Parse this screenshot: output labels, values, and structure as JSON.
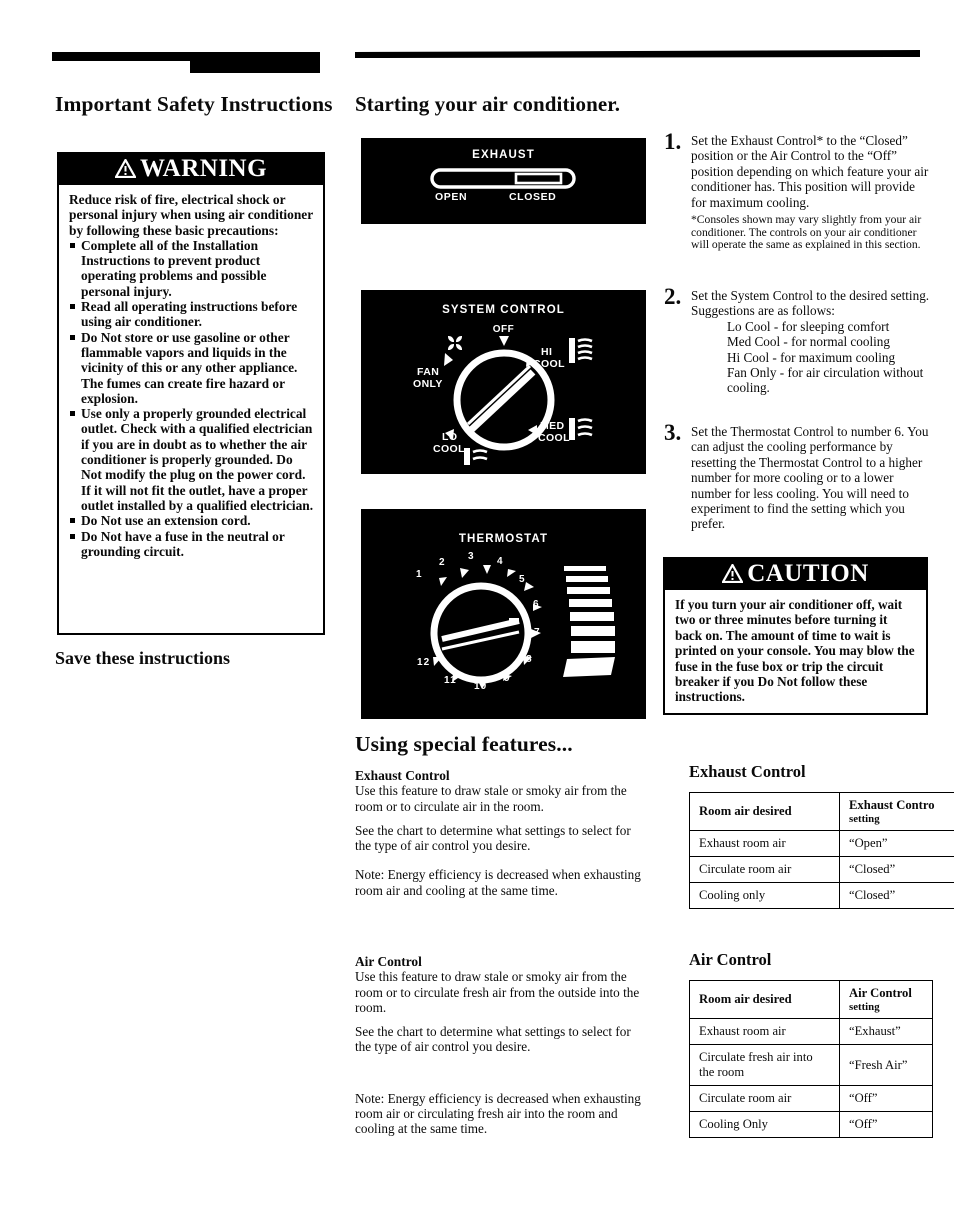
{
  "left_column": {
    "page_title": "Important Safety Instructions",
    "warning": {
      "banner_label": "WARNING",
      "intro": "Reduce risk of fire, electrical shock or personal injury when using air conditioner by following these basic precautions:",
      "bullets": [
        "Complete all of the Installation Instructions to prevent product operating problems and possible personal injury.",
        "Read all operating instructions before using air conditioner.",
        "Do Not store or use gasoline or other flammable vapors and liquids in the vicinity of this or any other appliance.  The fumes can create fire hazard or explosion.",
        "Use only a properly grounded electrical outlet.  Check with a qualified electrician if you are in doubt as to whether the air conditioner is properly grounded.  Do Not modify the plug on the power cord.  If it will not fit the outlet, have a proper outlet installed by a qualified electrician.",
        "Do Not use an extension cord.",
        "Do Not have a fuse in the neutral or grounding circuit."
      ]
    },
    "save_instructions": "Save these instructions"
  },
  "middle_column": {
    "section_title": "Starting your air conditioner.",
    "consoles": {
      "exhaust": {
        "title": "EXHAUST",
        "left_label": "OPEN",
        "right_label": "CLOSED"
      },
      "system_control": {
        "title": "SYSTEM CONTROL",
        "positions": [
          "OFF",
          "FAN ONLY",
          "HI COOL",
          "MED COOL",
          "LO COOL"
        ],
        "off_label": "OFF",
        "fan_only_label_1": "FAN",
        "fan_only_label_2": "ONLY",
        "hi_cool_label_1": "HI",
        "hi_cool_label_2": "COOL",
        "med_cool_label_1": "MED",
        "med_cool_label_2": "COOL",
        "lo_cool_label_1": "LO",
        "lo_cool_label_2": "COOL"
      },
      "thermostat": {
        "title": "THERMOSTAT",
        "numbers": [
          "1",
          "2",
          "3",
          "4",
          "5",
          "6",
          "7",
          "8",
          "9",
          "10",
          "11",
          "12"
        ]
      }
    },
    "special_features_title": "Using special features...",
    "exhaust_control": {
      "heading": "Exhaust Control",
      "p1": "Use this feature to draw stale or smoky air from the room or to circulate air in the room.",
      "p2": "See the chart to determine what settings to select for the type of air control you desire.",
      "p3": "Note: Energy efficiency is decreased when exhausting room air and cooling at the same time."
    },
    "air_control": {
      "heading": "Air Control",
      "p1": "Use this feature to draw stale or smoky air from the room or to circulate fresh air from the outside into the room.",
      "p2": "See the chart to determine what settings to select for the type of air control you desire.",
      "p3": "Note: Energy efficiency is decreased when exhausting room air or circulating fresh air into the room and cooling at the same time."
    }
  },
  "right_column": {
    "steps": [
      {
        "number": "1.",
        "text": "Set the Exhaust Control* to the “Closed” position or the Air Control to the “Off” position depending on which feature your air conditioner has.  This position will provide for maximum cooling.",
        "footnote": "*Consoles shown may vary slightly from your air conditioner.  The controls on your air conditioner will operate the same as explained in this section."
      },
      {
        "number": "2.",
        "text": "Set the System Control to the desired setting.  Suggestions are as follows:",
        "sublist": [
          "Lo Cool  - for sleeping comfort",
          "Med Cool - for normal cooling",
          "Hi Cool  - for maximum cooling",
          "Fan Only - for air circulation    without cooling."
        ]
      },
      {
        "number": "3.",
        "text": "Set the Thermostat Control to number 6.  You can adjust the cooling performance by resetting the Thermostat Control to a higher number for more cooling or to a lower number for less cooling.  You will need to experiment to find the setting which you prefer."
      }
    ],
    "caution": {
      "banner_label": "CAUTION",
      "text": "If you turn your air conditioner off, wait two or three minutes before turning it back on.  The amount of time to wait is printed on your console. You may blow the fuse in the fuse box or trip the circuit breaker if you Do Not follow these instructions."
    },
    "exhaust_table": {
      "title": "Exhaust Control",
      "header": {
        "col1": "Room air  desired",
        "col2_line1": "Exhaust Contro",
        "col2_line2": "setting"
      },
      "rows": [
        {
          "col1": "Exhaust room air",
          "col2": "“Open”"
        },
        {
          "col1": "Circulate room air",
          "col2": "“Closed”"
        },
        {
          "col1": "Cooling only",
          "col2": "“Closed”"
        }
      ]
    },
    "air_table": {
      "title": "Air Control",
      "header": {
        "col1": "Room air desired",
        "col2_line1": "Air Control",
        "col2_line2": "setting"
      },
      "rows": [
        {
          "col1": "Exhaust room air",
          "col2": "“Exhaust”"
        },
        {
          "col1": "Circulate fresh air into the room",
          "col2": "“Fresh Air”"
        },
        {
          "col1": "Circulate room air",
          "col2": "“Off”"
        },
        {
          "col1": "Cooling Only",
          "col2": "“Off”"
        }
      ]
    }
  },
  "colors": {
    "ink": "#000000",
    "paper": "#ffffff"
  }
}
